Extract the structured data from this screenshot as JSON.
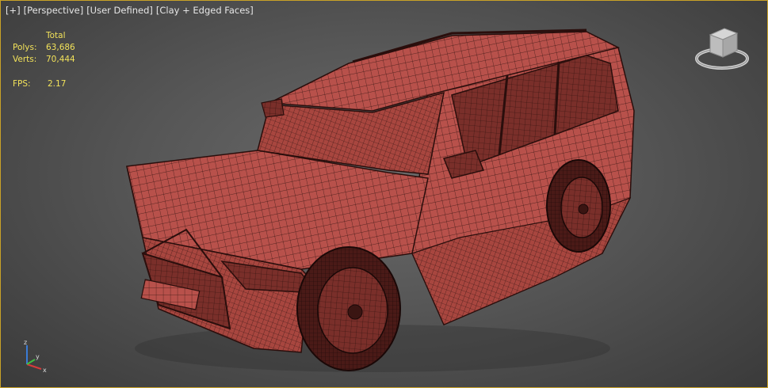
{
  "viewport": {
    "labels": [
      "[+]",
      "[Perspective]",
      "[User Defined]",
      "[Clay + Edged Faces]"
    ]
  },
  "stats": {
    "header": "Total",
    "polys_label": "Polys:",
    "polys_value": "63,686",
    "verts_label": "Verts:",
    "verts_value": "70,444",
    "fps_label": "FPS:",
    "fps_value": "2.17"
  },
  "viewcube": {
    "icon": "viewcube-icon"
  },
  "axis": {
    "icon": "axis-tripod-icon",
    "labels": [
      "z",
      "x",
      "y"
    ]
  },
  "colors": {
    "stats_text": "#f2e25a",
    "viewport_border": "#c9a227",
    "clay": "#b8514b",
    "wire": "#3a1714"
  }
}
